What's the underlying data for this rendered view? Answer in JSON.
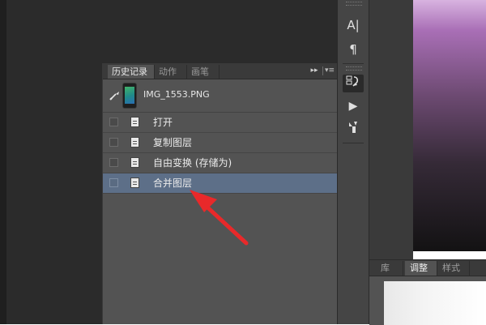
{
  "history_panel": {
    "tabs": {
      "history": "历史记录",
      "actions": "动作",
      "brush": "画笔"
    },
    "controls": {
      "collapse": "▸▸",
      "menu": "▾≡"
    },
    "snapshot": {
      "label": "IMG_1553.PNG"
    },
    "states": [
      {
        "label": "打开",
        "selected": false
      },
      {
        "label": "复制图层",
        "selected": false
      },
      {
        "label": "自由变换 (存储为)",
        "selected": false
      },
      {
        "label": "合并图层",
        "selected": true
      }
    ]
  },
  "tool_strip": {
    "character_icon": "A|",
    "paragraph_icon": "¶",
    "history_icon": "history-brush-icon",
    "play_icon": "▶",
    "tool_presets_icon": "tool-presets-icon"
  },
  "adjustments_panel": {
    "tabs": {
      "library": "库",
      "adjustments": "调整",
      "styles": "样式"
    }
  },
  "colors": {
    "panel_bg": "#535353",
    "selected_row": "#5d6f88",
    "arrow": "#e8292a"
  }
}
